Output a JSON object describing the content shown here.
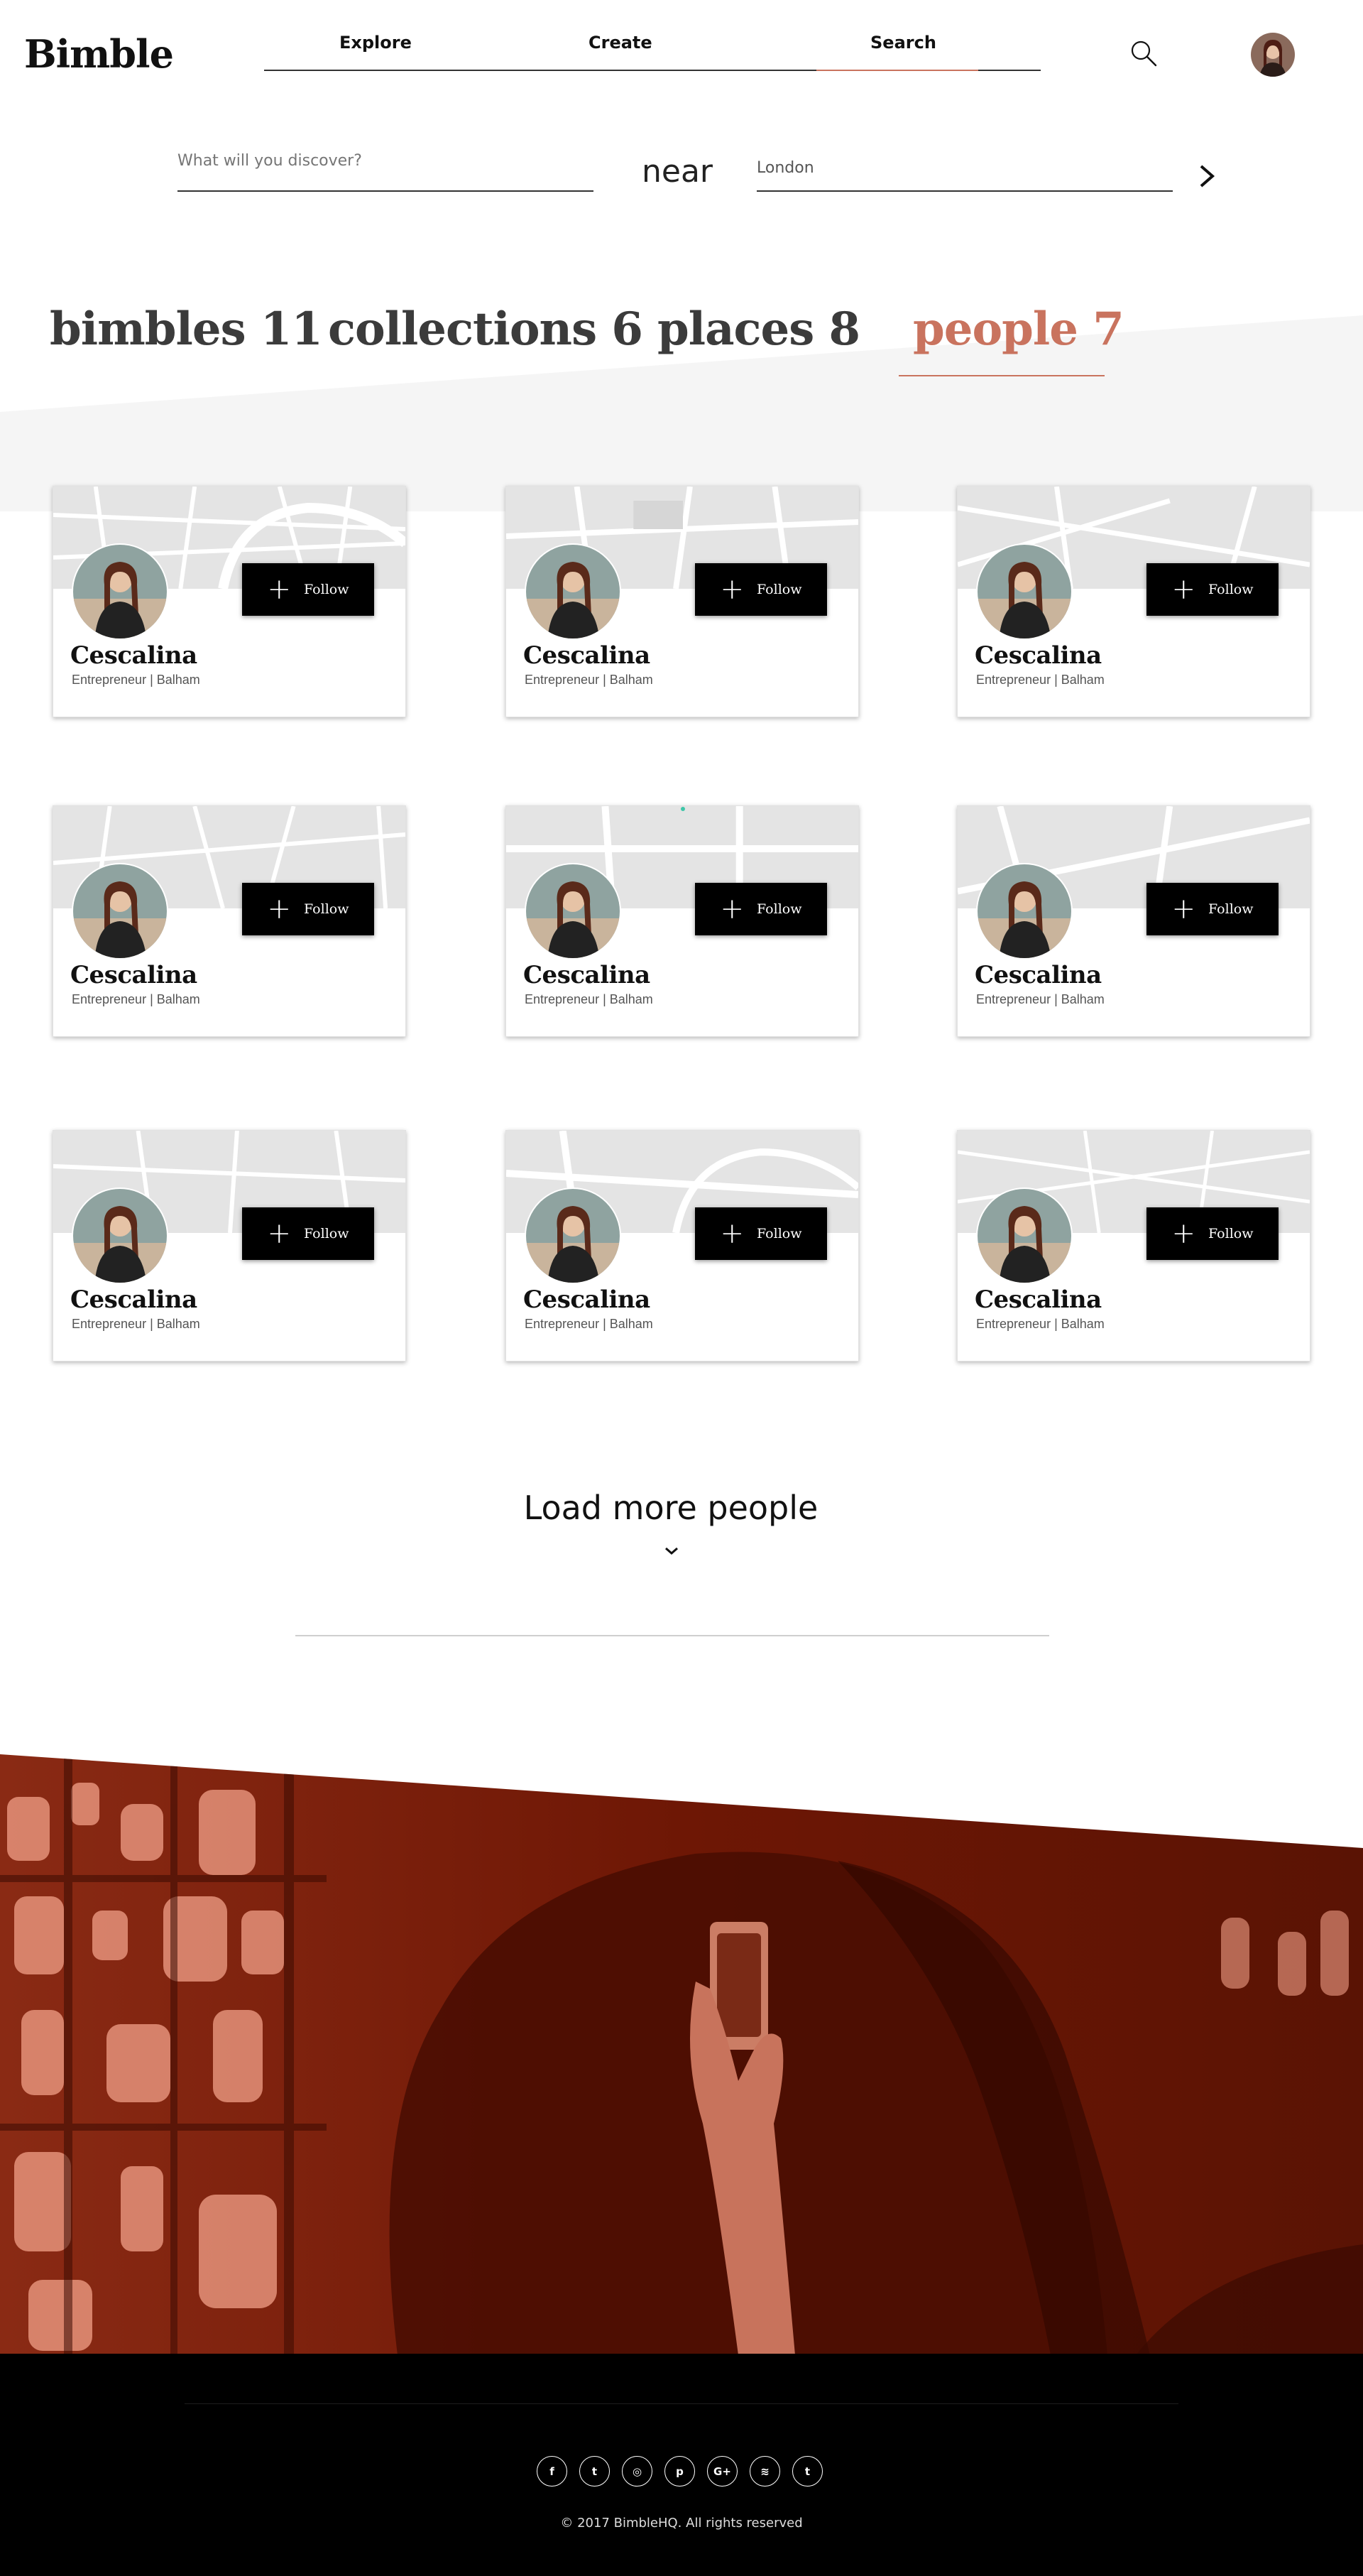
{
  "brand": {
    "logo_text": "Bimble",
    "accent": "#c9735e"
  },
  "nav": {
    "items": [
      {
        "label": "Explore"
      },
      {
        "label": "Create"
      },
      {
        "label": "Search",
        "active": true
      }
    ],
    "search_icon": "search-icon",
    "avatar_icon": "user-avatar"
  },
  "search": {
    "query_placeholder": "What will you discover?",
    "near_label": "near",
    "location_value": "London",
    "go_icon": "chevron-right-icon"
  },
  "tabs": [
    {
      "label": "bimbles 11"
    },
    {
      "label": "collections 6"
    },
    {
      "label": "places 8"
    },
    {
      "label": "people 7",
      "active": true
    }
  ],
  "people": [
    {
      "name": "Cescalina",
      "subtitle": "Entrepreneur | Balham",
      "follow_label": "Follow"
    },
    {
      "name": "Cescalina",
      "subtitle": "Entrepreneur | Balham",
      "follow_label": "Follow"
    },
    {
      "name": "Cescalina",
      "subtitle": "Entrepreneur | Balham",
      "follow_label": "Follow"
    },
    {
      "name": "Cescalina",
      "subtitle": "Entrepreneur | Balham",
      "follow_label": "Follow"
    },
    {
      "name": "Cescalina",
      "subtitle": "Entrepreneur | Balham",
      "follow_label": "Follow"
    },
    {
      "name": "Cescalina",
      "subtitle": "Entrepreneur | Balham",
      "follow_label": "Follow"
    },
    {
      "name": "Cescalina",
      "subtitle": "Entrepreneur | Balham",
      "follow_label": "Follow"
    },
    {
      "name": "Cescalina",
      "subtitle": "Entrepreneur | Balham",
      "follow_label": "Follow"
    },
    {
      "name": "Cescalina",
      "subtitle": "Entrepreneur | Balham",
      "follow_label": "Follow"
    }
  ],
  "load_more": {
    "label": "Load more people",
    "icon": "chevron-down-icon"
  },
  "footer": {
    "socials": [
      {
        "icon": "facebook-icon",
        "glyph": "f"
      },
      {
        "icon": "twitter-icon",
        "glyph": "t"
      },
      {
        "icon": "instagram-icon",
        "glyph": "◎"
      },
      {
        "icon": "pinterest-icon",
        "glyph": "p"
      },
      {
        "icon": "google-plus-icon",
        "glyph": "G+"
      },
      {
        "icon": "spotify-icon",
        "glyph": "≋"
      },
      {
        "icon": "tumblr-icon",
        "glyph": "t"
      }
    ],
    "copyright": "© 2017 BimbleHQ. All rights reserved"
  },
  "colors": {
    "hero_tint": "#6e1705",
    "hero_highlight": "#f2a088",
    "footer_bg": "#000000",
    "band_bg": "#f5f5f5"
  }
}
